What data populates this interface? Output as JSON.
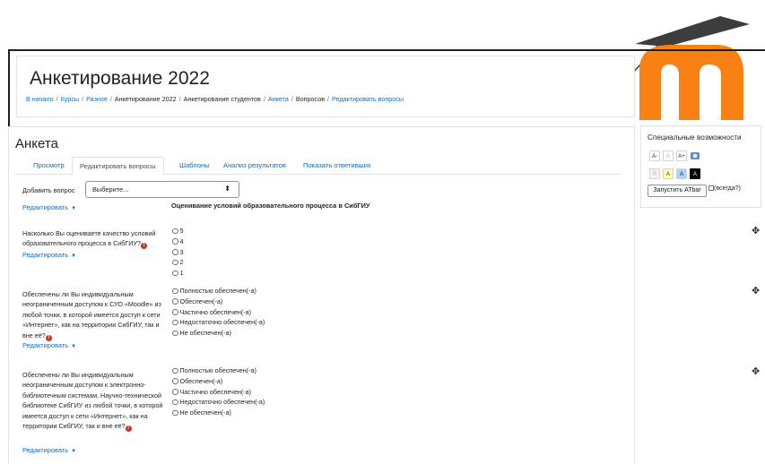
{
  "header": {
    "title": "Анкетирование 2022",
    "breadcrumb": [
      "В начало",
      "Курсы",
      "Разное",
      "Анкетирование 2022",
      "Анкетирование студентов",
      "Анкета",
      "Вопросов",
      "Редактировать вопросы"
    ]
  },
  "main": {
    "title": "Анкета",
    "tabs": [
      "Просмотр",
      "Редактировать вопросы",
      "Шаблоны",
      "Анализ результатов",
      "Показать ответивших"
    ],
    "add_question_label": "Добавить вопрос",
    "select_value": "Выберите...",
    "edit_label": "Редактировать",
    "section_heading": "Оценивание условий образовательного процесса в СибГИУ",
    "questions": [
      {
        "text": "Насколько Вы оцениваете качество условий образовательного процесса в СибГИУ?",
        "options": [
          "5",
          "4",
          "3",
          "2",
          "1"
        ]
      },
      {
        "text": "Обеспечены ли Вы индивидуальным неограниченным доступом к СУО «Moodle» из любой точки, в которой имеется доступ к сети «Интернет», как на территории СибГИУ, так и вне её?",
        "options": [
          "Полностью обеспечен(-а)",
          "Обеспечен(-а)",
          "Частично обеспечен(-а)",
          "Недостаточно обеспечен(-а)",
          "Не обеспечен(-а)"
        ]
      },
      {
        "text": "Обеспечены ли Вы индивидуальным неограниченным доступом к электронно-библиотечным системам, Научно-технической библиотеке СибГИУ из любой точки, в которой имеется доступ к сети «Интернет», как на территории СибГИУ, так и вне её?",
        "options": [
          "Полностью обеспечен(-а)",
          "Обеспечен(-а)",
          "Частично обеспечен(-а)",
          "Недостаточно обеспечен(-а)",
          "Не обеспечен(-а)"
        ]
      }
    ]
  },
  "accessibility": {
    "title": "Специальные возможности",
    "size_buttons": [
      "A-",
      "A",
      "A+"
    ],
    "color_buttons": [
      "R",
      "A",
      "A",
      "A"
    ],
    "launch_label": "Запустить ATbar",
    "always_label": "(всегда?)"
  },
  "colors": {
    "link": "#0f6cbf",
    "moodle_orange": "#f98012",
    "required": "#ca3120"
  }
}
